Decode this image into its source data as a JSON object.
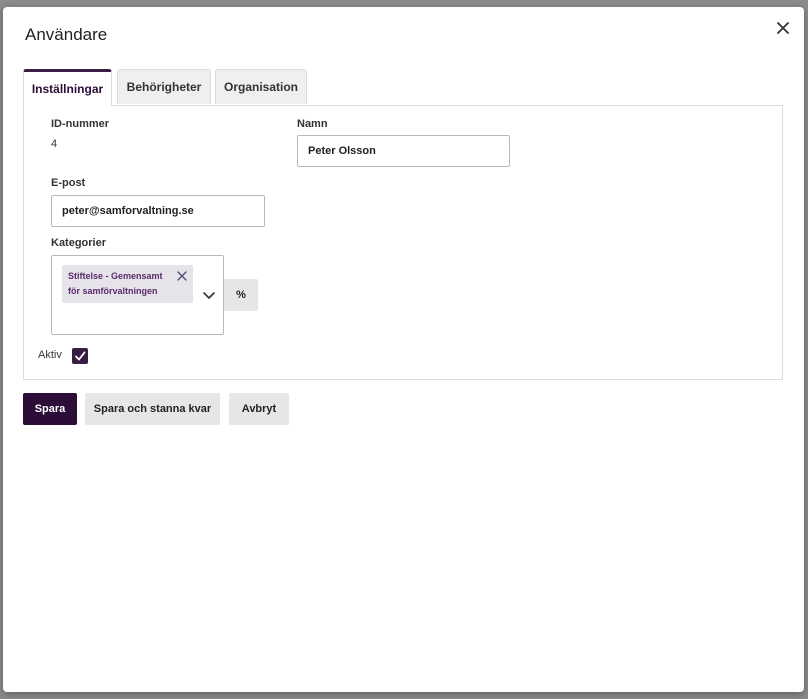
{
  "dialog": {
    "title": "Användare",
    "close_icon": "close-icon"
  },
  "tabs": [
    {
      "label": "Inställningar",
      "active": true
    },
    {
      "label": "Behörigheter",
      "active": false
    },
    {
      "label": "Organisation",
      "active": false
    }
  ],
  "form": {
    "id_label": "ID-nummer",
    "id_value": "4",
    "name_label": "Namn",
    "name_value": "Peter Olsson",
    "email_label": "E-post",
    "email_value": "peter@samforvaltning.se",
    "categories_label": "Kategorier",
    "categories_selected": [
      "Stiftelse - Gemensamt för samförvaltningen"
    ],
    "percent_label": "%",
    "active_label": "Aktiv",
    "active_checked": true
  },
  "actions": {
    "save": "Spara",
    "save_stay": "Spara och stanna kvar",
    "cancel": "Avbryt"
  },
  "colors": {
    "accent": "#2b0d38",
    "chip_bg": "#e6e4ea",
    "chip_text": "#5a2a6a",
    "secondary_bg": "#e6e6e6"
  }
}
